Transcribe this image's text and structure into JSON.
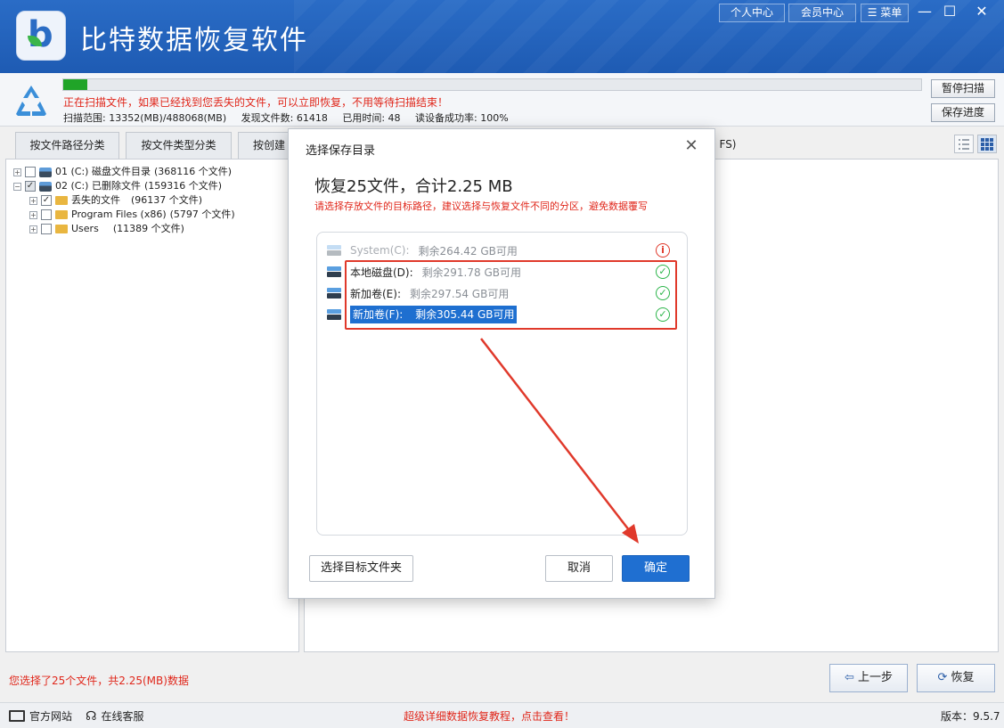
{
  "app": {
    "title": "比特数据恢复软件",
    "top_buttons": [
      "个人中心",
      "会员中心",
      "菜单"
    ],
    "window_controls": [
      "—",
      "☐",
      "✕"
    ]
  },
  "scan": {
    "progress_percent": 2.8,
    "message": "正在扫描文件，如果已经找到您丢失的文件，可以立即恢复，不用等待扫描结束！",
    "range": "扫描范围: 13352(MB)/488068(MB)",
    "found": "发现文件数: 61418",
    "elapsed": "已用时间: 48",
    "read_rate": "读设备成功率: 100%",
    "pause_button": "暂停扫描",
    "save_button": "保存进度"
  },
  "tabs": [
    "按文件路径分类",
    "按文件类型分类",
    "按创建",
    "FS)"
  ],
  "tree": [
    {
      "label": "01 (C:) 磁盘文件目录",
      "count": "(368116 个文件)"
    },
    {
      "label": "02 (C:) 已删除文件",
      "count": "(159316 个文件)"
    },
    {
      "label": "丢失的文件",
      "count": "(96137 个文件)"
    },
    {
      "label": "Program Files (x86)",
      "count": "(5797 个文件)"
    },
    {
      "label": "Users",
      "count": "(11389 个文件)"
    }
  ],
  "status": {
    "selection": "您选择了25个文件，共2.25(MB)数据",
    "prev_button": "上一步",
    "recover_button": "恢复"
  },
  "footer": {
    "website": "官方网站",
    "support": "在线客服",
    "tutorial": "超级详细数据恢复教程，点击查看！",
    "version": "版本：9.5.7"
  },
  "modal": {
    "title": "选择保存目录",
    "heading": "恢复25文件，合计2.25 MB",
    "hint": "请选择存放文件的目标路径，建议选择与恢复文件不同的分区，避免数据覆写",
    "drives": [
      {
        "name": "System(C):",
        "free": "剩余264.42 GB可用",
        "status": "warning"
      },
      {
        "name": "本地磁盘(D):",
        "free": "剩余291.78 GB可用",
        "status": "ok"
      },
      {
        "name": "新加卷(E):",
        "free": "剩余297.54 GB可用",
        "status": "ok"
      },
      {
        "name": "新加卷(F):",
        "free": "剩余305.44 GB可用",
        "status": "ok"
      }
    ],
    "choose_folder_button": "选择目标文件夹",
    "cancel_button": "取消",
    "confirm_button": "确定"
  },
  "colors": {
    "titlebar": "#2a6cc6",
    "accent": "#1f6fd1",
    "warning_text": "#e0271b",
    "progress": "#20a428",
    "annotation": "#e0392b"
  }
}
